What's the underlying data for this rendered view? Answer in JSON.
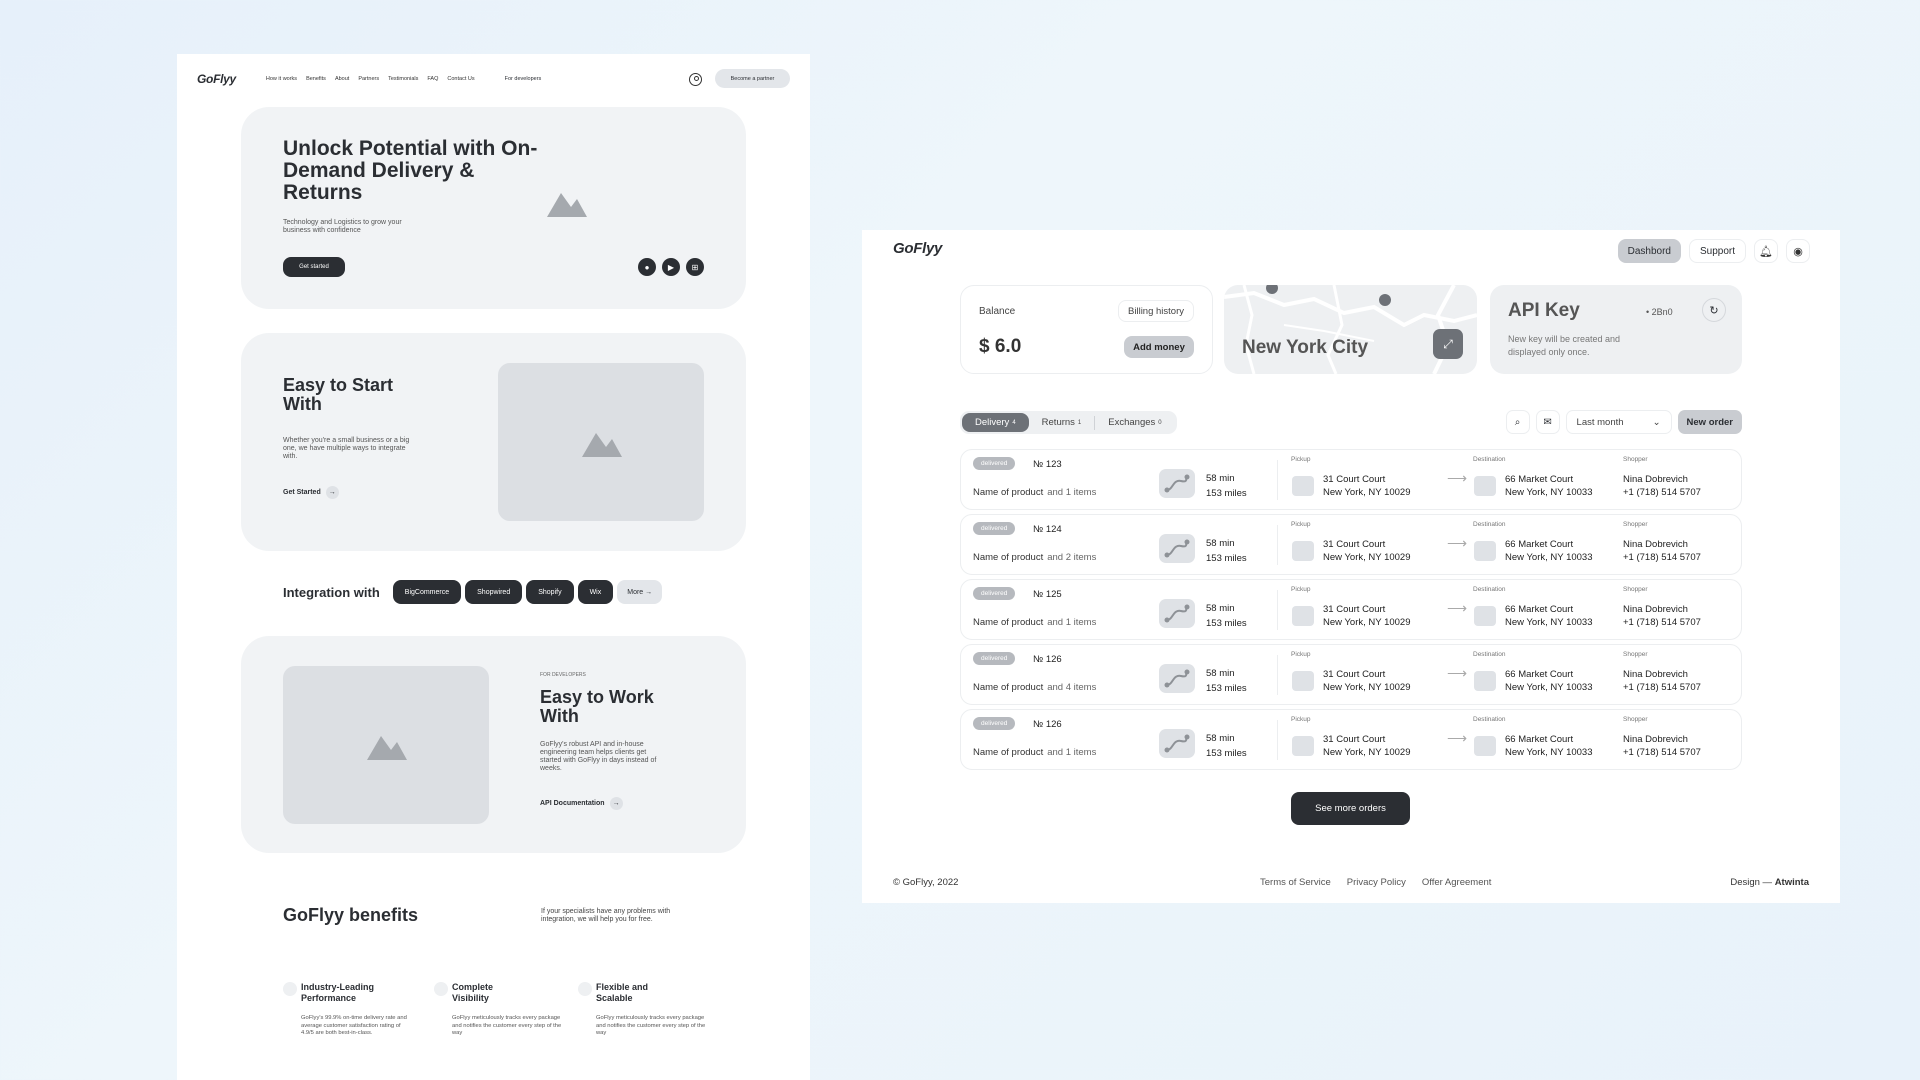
{
  "left_page": {
    "logo": "GoFlyy",
    "nav": [
      "How it works",
      "Benefits",
      "About",
      "Partners",
      "Testimonials",
      "FAQ",
      "Contact Us"
    ],
    "developers_link": "For developers",
    "partner_button": "Become a partner",
    "hero": {
      "title": "Unlock Potential with On-Demand Delivery & Returns",
      "subtitle": "Technology and Logistics to grow your business with confidence",
      "cta": "Get started"
    },
    "easy_start": {
      "title": "Easy to Start With",
      "text": " Whether you're a small business or a big one, we have multiple ways to integrate with.",
      "link": "Get Started"
    },
    "integration": {
      "label": "Integration with",
      "chips": [
        "BigCommerce",
        "Shopwired",
        "Shopify",
        "Wix"
      ],
      "more": "More"
    },
    "easy_work": {
      "tag": "For developers",
      "title": "Easy to Work With",
      "text": "GoFlyy's robust API and in-house engineering team helps clients get started with GoFlyy in days instead of weeks.",
      "link": "API Documentation"
    },
    "benefits": {
      "title": "GoFlyy benefits",
      "subtitle": "If your specialists have any problems with integration, we will help you for free.",
      "items": [
        {
          "title": "Industry-Leading Performance",
          "text": "GoFlyy's 99.9% on-time delivery rate and average customer satisfaction rating of 4.9/5 are both best-in-class."
        },
        {
          "title": "Complete Visibility",
          "text": "GoFlyy meticulously tracks every package and notifies the customer every step of the way"
        },
        {
          "title": "Flexible and Scalable",
          "text": "GoFlyy meticulously tracks every package and notifies the customer every step of the way"
        }
      ]
    }
  },
  "dashboard": {
    "logo": "GoFlyy",
    "nav": {
      "dashboard": "Dashbord",
      "support": "Support"
    },
    "balance": {
      "label": "Balance",
      "value": "$ 6.0",
      "billing": "Billing history",
      "add": "Add money"
    },
    "map": {
      "city": "New York City"
    },
    "api": {
      "title": "API Key",
      "key": "• 2Bn0",
      "note": "New key will be created and displayed only once."
    },
    "tabs": [
      {
        "label": "Delivery",
        "count": "4"
      },
      {
        "label": "Returns",
        "count": "1"
      },
      {
        "label": "Exchanges",
        "count": "0"
      }
    ],
    "period": "Last month",
    "new_order": "New order",
    "labels": {
      "pickup": "Pickup",
      "destination": "Destination",
      "shopper": "Shopper"
    },
    "orders": [
      {
        "status": "delivered",
        "number": "№ 123",
        "product": "Name of product",
        "more": "and 1 items",
        "time": "58 min",
        "distance": "153 miles",
        "pickup1": "31 Court Court",
        "pickup2": "New York, NY 10029",
        "dest1": "66 Market Court",
        "dest2": "New York, NY 10033",
        "shopper": "Nina Dobrevich",
        "phone": "+1 (718) 514 5707"
      },
      {
        "status": "delivered",
        "number": "№ 124",
        "product": "Name of product",
        "more": "and 2 items",
        "time": "58 min",
        "distance": "153 miles",
        "pickup1": "31 Court Court",
        "pickup2": "New York, NY 10029",
        "dest1": "66 Market Court",
        "dest2": "New York, NY 10033",
        "shopper": "Nina Dobrevich",
        "phone": "+1 (718) 514 5707"
      },
      {
        "status": "delivered",
        "number": "№ 125",
        "product": "Name of product",
        "more": "and 1 items",
        "time": "58 min",
        "distance": "153 miles",
        "pickup1": "31 Court Court",
        "pickup2": "New York, NY 10029",
        "dest1": "66 Market Court",
        "dest2": "New York, NY 10033",
        "shopper": "Nina Dobrevich",
        "phone": "+1 (718) 514 5707"
      },
      {
        "status": "delivered",
        "number": "№ 126",
        "product": "Name of product",
        "more": "and 4 items",
        "time": "58 min",
        "distance": "153 miles",
        "pickup1": "31 Court Court",
        "pickup2": "New York, NY 10029",
        "dest1": "66 Market Court",
        "dest2": "New York, NY 10033",
        "shopper": "Nina Dobrevich",
        "phone": "+1 (718) 514 5707"
      },
      {
        "status": "delivered",
        "number": "№ 126",
        "product": "Name of product",
        "more": "and 1 items",
        "time": "58 min",
        "distance": "153 miles",
        "pickup1": "31 Court Court",
        "pickup2": "New York, NY 10029",
        "dest1": "66 Market Court",
        "dest2": "New York, NY 10033",
        "shopper": "Nina Dobrevich",
        "phone": "+1 (718) 514 5707"
      }
    ],
    "see_more": "See more orders",
    "footer": {
      "copyright": "© GoFlyy, 2022",
      "links": [
        "Terms of Service",
        "Privacy Policy",
        "Offer Agreement"
      ],
      "credit_prefix": "Design — ",
      "credit_name": "Atwinta"
    }
  },
  "icons": {
    "user": "user-circle-icon",
    "bell": "bell-icon",
    "search": "search-icon",
    "mail": "mail-icon",
    "refresh": "refresh-icon",
    "chevron": "chevron-down-icon",
    "arrow": "arrow-right-icon",
    "image": "image-placeholder-icon",
    "route": "route-icon",
    "expand": "expand-icon",
    "apple": "apple-icon",
    "play": "play-store-icon",
    "windows": "windows-icon"
  },
  "colors": {
    "accent_dark": "#2b2e33",
    "muted": "#c9ccd1",
    "card_bg": "#f1f3f5",
    "badge": "#b6b9be"
  }
}
